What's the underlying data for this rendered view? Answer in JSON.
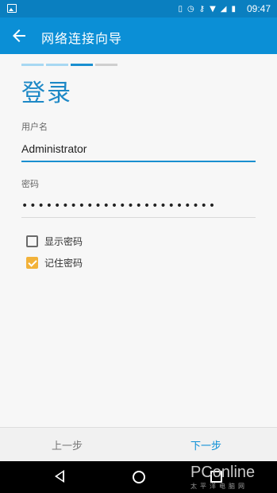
{
  "status_bar": {
    "time": "09:47",
    "icons": [
      "image-icon",
      "vibrate-icon",
      "alarm-icon",
      "key-icon",
      "wifi-icon",
      "signal-icon",
      "battery-icon"
    ]
  },
  "app_bar": {
    "title": "网络连接向导",
    "back_icon": "arrow-left-icon",
    "color": "#0b8fd6"
  },
  "wizard": {
    "steps": [
      "done",
      "done",
      "current",
      "todo"
    ]
  },
  "form": {
    "heading": "登录",
    "username_label": "用户名",
    "username_value": "Administrator",
    "password_label": "密码",
    "password_value": "••••••••••••••••••••••••",
    "options": [
      {
        "label": "显示密码",
        "checked": false
      },
      {
        "label": "记住密码",
        "checked": true
      }
    ]
  },
  "footer": {
    "prev_label": "上一步",
    "next_label": "下一步"
  },
  "watermark": {
    "brand": "PConline",
    "sub": "太平洋电脑网"
  }
}
